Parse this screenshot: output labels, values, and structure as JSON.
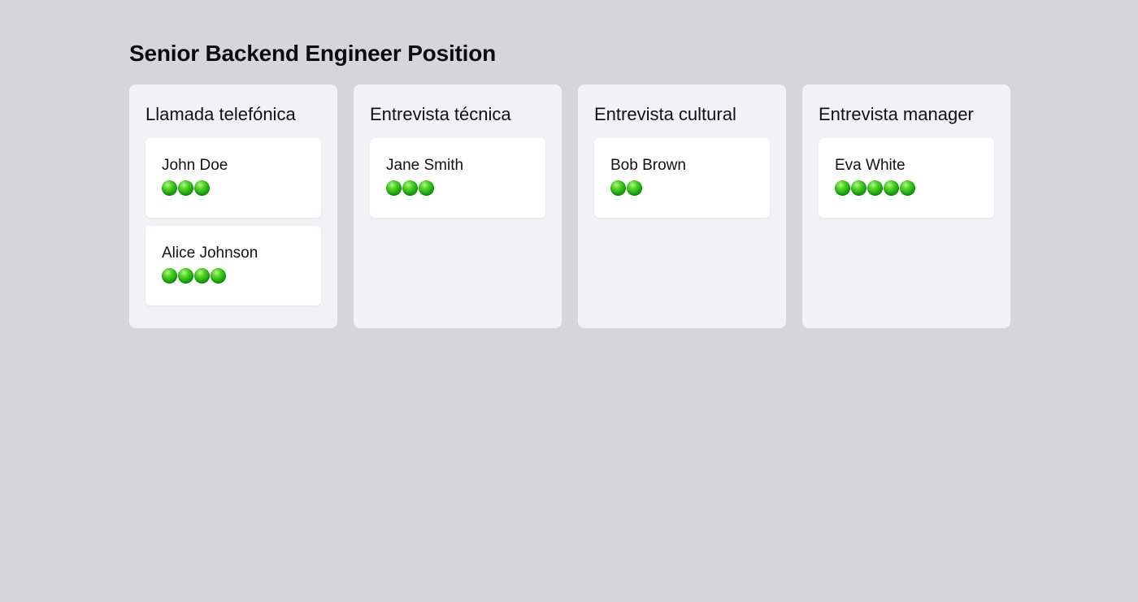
{
  "board": {
    "title": "Senior Backend Engineer Position"
  },
  "columns": [
    {
      "title": "Llamada telefónica",
      "cards": [
        {
          "name": "John Doe",
          "rating": 3
        },
        {
          "name": "Alice Johnson",
          "rating": 4
        }
      ]
    },
    {
      "title": "Entrevista técnica",
      "cards": [
        {
          "name": "Jane Smith",
          "rating": 3
        }
      ]
    },
    {
      "title": "Entrevista cultural",
      "cards": [
        {
          "name": "Bob Brown",
          "rating": 2
        }
      ]
    },
    {
      "title": "Entrevista manager",
      "cards": [
        {
          "name": "Eva White",
          "rating": 5
        }
      ]
    }
  ],
  "colors": {
    "page_background": "#d5d5da",
    "column_background": "#f2f2f6",
    "card_background": "#ffffff",
    "rating_dot": "#18a80d"
  },
  "icons": {
    "rating_dot": "green-circle-icon"
  }
}
